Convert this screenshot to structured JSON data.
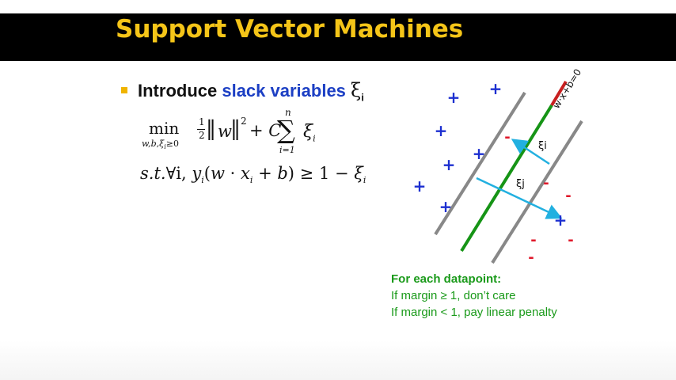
{
  "slide": {
    "title": "Support Vector Machines",
    "bullet": {
      "prefix": "Introduce ",
      "highlight": "slack variables",
      "symbol": "ξ",
      "symbol_sub": "i"
    },
    "objective": {
      "operator": "min",
      "operator_sub": "w,b,ξ",
      "operator_sub_i": "i",
      "operator_sub_tail": "≥0",
      "half_num": "1",
      "half_den": "2",
      "norm_open": "‖",
      "w": "w",
      "norm_close": "‖",
      "power": "2",
      "plus_c": "+ C",
      "sigma": "∑",
      "sum_upper": "n",
      "sum_lower": "i=1",
      "xi": "ξ",
      "xi_sub": "i"
    },
    "constraint": {
      "st": "s.t.",
      "forall": "∀i,",
      "y": "y",
      "y_sub": "i",
      "open": "(",
      "w": "w",
      "dot": "·",
      "x": "x",
      "x_sub": "i",
      "plus_b": "+ b",
      "close": ")",
      "rel": "≥ 1 −",
      "xi": "ξ",
      "xi_sub": "i"
    },
    "diagram": {
      "boundary_label": "w·x+b=0",
      "slack_label_i": "ξi",
      "slack_label_j": "ξj",
      "plus_symbol": "+",
      "minus_symbol": "-",
      "colors": {
        "plus": "#1c2fd0",
        "minus": "#e0182a",
        "boundary": "#169416",
        "margin": "#888888",
        "arrow": "#22b0e0",
        "accent": "#c82020"
      }
    },
    "notes": {
      "heading": "For each datapoint:",
      "line1": "If margin ≥ 1, don’t care",
      "line2": "If margin < 1, pay linear penalty"
    }
  }
}
